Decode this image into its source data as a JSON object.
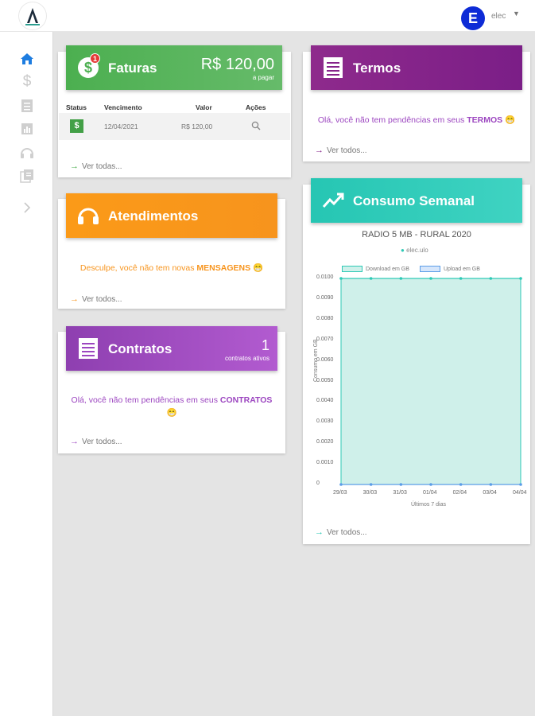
{
  "header": {
    "avatar_letter": "E",
    "user_name": "elec"
  },
  "sidebar": {
    "items": [
      {
        "name": "home-icon",
        "active": true
      },
      {
        "name": "dollar-icon",
        "active": false
      },
      {
        "name": "document-icon",
        "active": false
      },
      {
        "name": "chart-icon",
        "active": false
      },
      {
        "name": "headset-icon",
        "active": false
      },
      {
        "name": "library-icon",
        "active": false
      },
      {
        "name": "chevron-right-icon",
        "active": false
      }
    ]
  },
  "faturas": {
    "title": "Faturas",
    "badge": "1",
    "amount": "R$ 120,00",
    "amount_sub": "a pagar",
    "columns": [
      "Status",
      "Vencimento",
      "Valor",
      "Ações"
    ],
    "rows": [
      {
        "status_symbol": "$",
        "vencimento": "12/04/2021",
        "valor": "R$ 120,00"
      }
    ],
    "link": "Ver todas..."
  },
  "atendimentos": {
    "title": "Atendimentos",
    "message_pre": "Desculpe, você não tem novas ",
    "message_bold": "MENSAGENS",
    "emoji": "😁",
    "link": "Ver todos..."
  },
  "contratos": {
    "title": "Contratos",
    "count": "1",
    "count_sub": "contratos ativos",
    "message_pre": "Olá, você não tem pendências em seus ",
    "message_bold": "CONTRATOS",
    "emoji": "😁",
    "link": "Ver todos..."
  },
  "termos": {
    "title": "Termos",
    "message_pre": "Olá, você não tem pendências em seus ",
    "message_bold": "TERMOS",
    "emoji": "😁",
    "link": "Ver todos..."
  },
  "consumo": {
    "title": "Consumo Semanal",
    "plan": "RADIO 5 MB - RURAL 2020",
    "user": "elec.ulo",
    "link": "Ver todos..."
  },
  "colors": {
    "faturas": "#4caf50",
    "atendimentos": "#f7941d",
    "contratos": "#9c46c0",
    "termos": "#86248a",
    "consumo": "#2ec9b6",
    "download_fill": "#cff0ea",
    "upload_line": "#5b9de8"
  },
  "chart_data": {
    "type": "area",
    "title": "RADIO 5 MB - RURAL 2020",
    "xlabel": "Últimos 7 dias",
    "ylabel": "Consumo em GB",
    "x": [
      "29/03",
      "30/03",
      "31/03",
      "01/04",
      "02/04",
      "03/04",
      "04/04"
    ],
    "series": [
      {
        "name": "Download em GB",
        "values": [
          0.01,
          0.01,
          0.01,
          0.01,
          0.01,
          0.01,
          0.01
        ]
      },
      {
        "name": "Upload em GB",
        "values": [
          0,
          0,
          0,
          0,
          0,
          0,
          0
        ]
      }
    ],
    "yticks": [
      "0.0100",
      "0.0090",
      "0.0080",
      "0.0070",
      "0.0060",
      "0.0050",
      "0.0040",
      "0.0030",
      "0.0020",
      "0.0010",
      "0"
    ],
    "ylim": [
      0,
      0.01
    ],
    "grid": true,
    "legend": "top"
  }
}
